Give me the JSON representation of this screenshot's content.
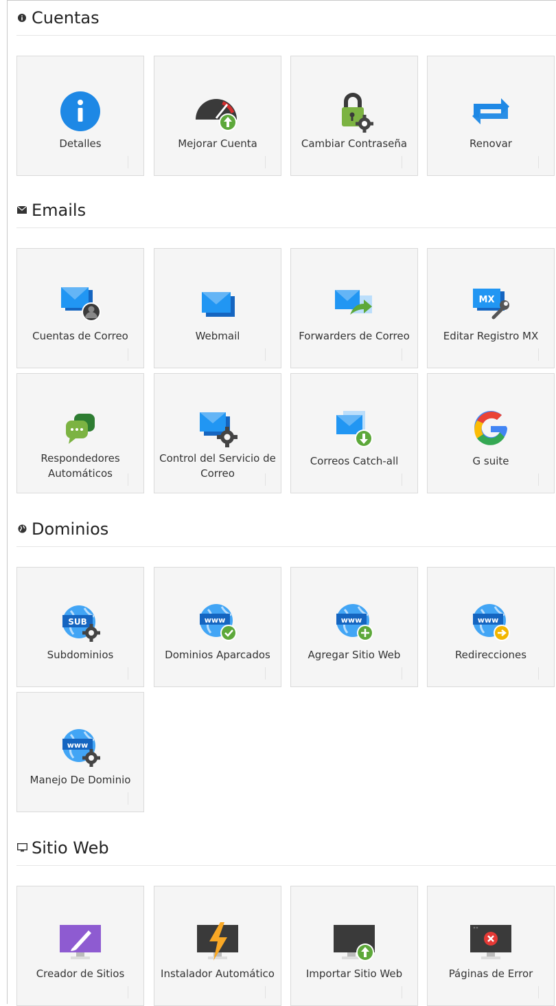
{
  "sections": [
    {
      "title": "Cuentas",
      "icon": "info-circle-icon",
      "tiles": [
        {
          "label": "Detalles",
          "icon": "info-icon"
        },
        {
          "label": "Mejorar Cuenta",
          "icon": "speedometer-upgrade-icon"
        },
        {
          "label": "Cambiar Contraseña",
          "icon": "padlock-gear-icon"
        },
        {
          "label": "Renovar",
          "icon": "renew-arrows-icon"
        }
      ]
    },
    {
      "title": "Emails",
      "icon": "envelope-icon",
      "tiles": [
        {
          "label": "Cuentas de Correo",
          "icon": "mail-user-icon"
        },
        {
          "label": "Webmail",
          "icon": "mail-icon"
        },
        {
          "label": "Forwarders de Correo",
          "icon": "mail-forward-icon"
        },
        {
          "label": "Editar Registro MX",
          "icon": "mx-wrench-icon"
        },
        {
          "label": "Respondedores Automáticos",
          "icon": "chat-bubbles-icon"
        },
        {
          "label": "Control del Servicio de Correo",
          "icon": "mail-gear-icon"
        },
        {
          "label": "Correos Catch-all",
          "icon": "mail-download-icon"
        },
        {
          "label": "G suite",
          "icon": "google-icon"
        }
      ]
    },
    {
      "title": "Dominios",
      "icon": "globe-icon",
      "tiles": [
        {
          "label": "Subdominios",
          "icon": "globe-sub-gear-icon"
        },
        {
          "label": "Dominios Aparcados",
          "icon": "globe-www-check-icon"
        },
        {
          "label": "Agregar Sitio Web",
          "icon": "globe-www-plus-icon"
        },
        {
          "label": "Redirecciones",
          "icon": "globe-www-arrow-icon"
        },
        {
          "label": "Manejo De Dominio",
          "icon": "globe-www-gear-icon"
        }
      ]
    },
    {
      "title": "Sitio Web",
      "icon": "monitor-icon",
      "tiles": [
        {
          "label": "Creador de Sitios",
          "icon": "monitor-brush-icon"
        },
        {
          "label": "Instalador Automático",
          "icon": "monitor-bolt-icon"
        },
        {
          "label": "Importar Sitio Web",
          "icon": "monitor-upload-icon"
        },
        {
          "label": "Páginas de Error",
          "icon": "monitor-error-icon"
        }
      ]
    }
  ],
  "icon_text": {
    "sub": "SUB",
    "www": "www",
    "mx": "MX"
  },
  "colors": {
    "blue": "#1e88e5",
    "green": "#5da83a",
    "orange": "#f2b600",
    "purple": "#8e5bd1",
    "dark": "#333333"
  }
}
